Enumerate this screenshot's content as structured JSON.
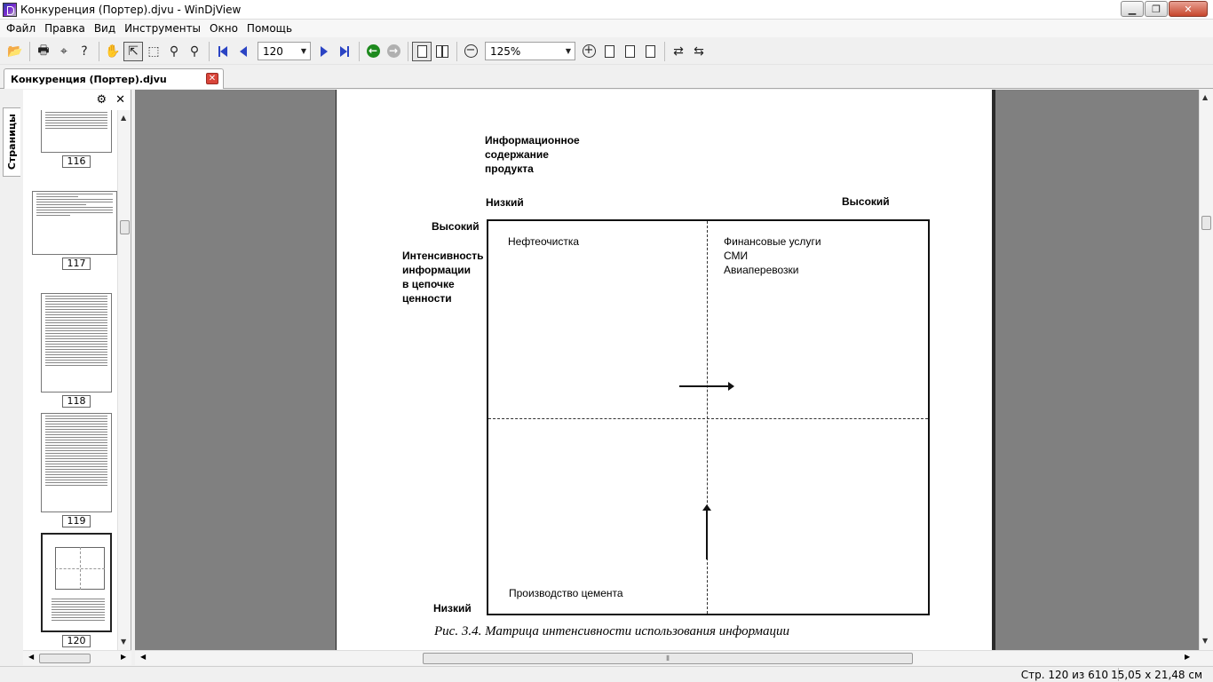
{
  "window": {
    "title": "Конкуренция (Портер).djvu - WinDjView"
  },
  "menu": [
    "Файл",
    "Правка",
    "Вид",
    "Инструменты",
    "Окно",
    "Помощь"
  ],
  "toolbar": {
    "page_value": "120",
    "zoom_value": "125%"
  },
  "tab": {
    "label": "Конкуренция (Портер).djvu"
  },
  "sidebar": {
    "vertical_tab": "Страницы",
    "thumbnails": [
      "116",
      "117",
      "118",
      "119",
      "120"
    ]
  },
  "page": {
    "heading_line1": "Информационное",
    "heading_line2": "содержание",
    "heading_line3": "продукта",
    "col_low": "Низкий",
    "col_high": "Высокий",
    "row_high": "Высокий",
    "row_label_line1": "Интенсивность",
    "row_label_line2": "информации",
    "row_label_line3": "в цепочке",
    "row_label_line4": "ценности",
    "row_low": "Низкий",
    "q1": "Нефтеочистка",
    "q2_line1": "Финансовые услуги",
    "q2_line2": "СМИ",
    "q2_line3": "Авиаперевозки",
    "q3": "Производство цемента",
    "caption": "Рис. 3.4. Матрица интенсивности использования информации"
  },
  "status": {
    "page_info": "Стр. 120 из 610",
    "page_size": "15,05 х 21,48 см"
  }
}
